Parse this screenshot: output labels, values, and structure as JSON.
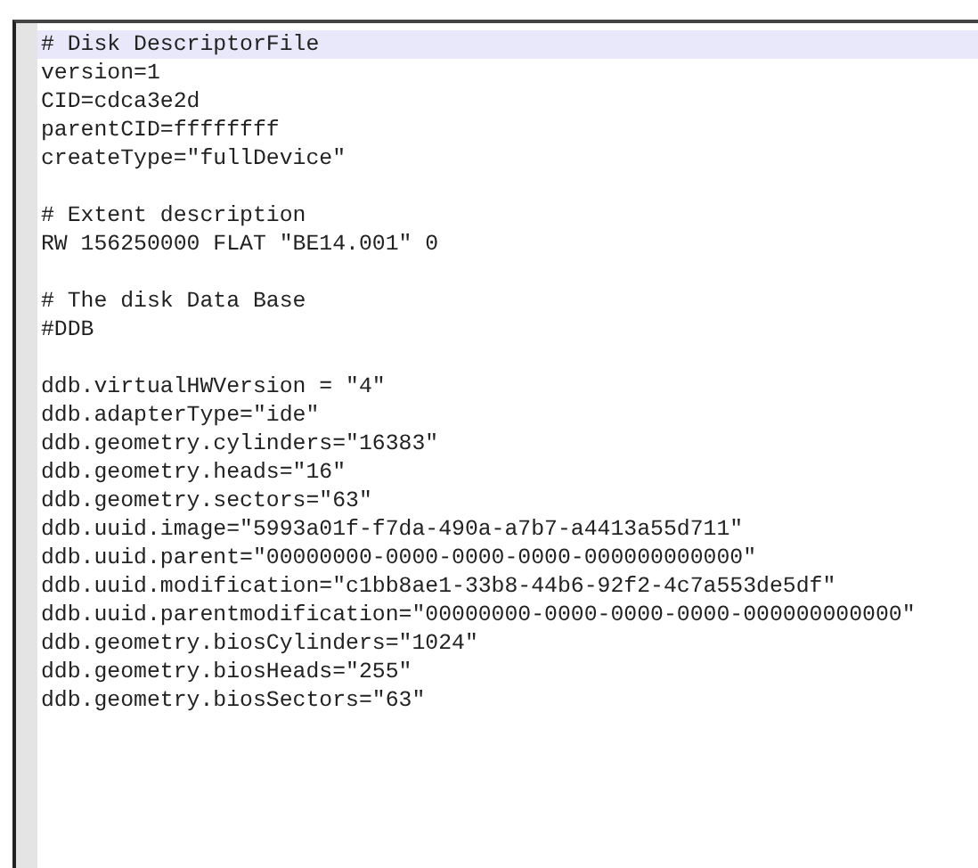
{
  "editor": {
    "blocks": [
      [
        {
          "text": "# Disk DescriptorFile",
          "current": true
        },
        {
          "text": "version=1",
          "current": false
        },
        {
          "text": "CID=cdca3e2d",
          "current": false
        },
        {
          "text": "parentCID=ffffffff",
          "current": false
        },
        {
          "text": "createType=\"fullDevice\"",
          "current": false
        }
      ],
      [
        {
          "text": "# Extent description",
          "current": false
        },
        {
          "text": "RW 156250000 FLAT \"BE14.001\" 0",
          "current": false
        }
      ],
      [
        {
          "text": "# The disk Data Base",
          "current": false
        },
        {
          "text": "#DDB",
          "current": false
        }
      ],
      [
        {
          "text": "ddb.virtualHWVersion = \"4\"",
          "current": false
        },
        {
          "text": "ddb.adapterType=\"ide\"",
          "current": false
        },
        {
          "text": "ddb.geometry.cylinders=\"16383\"",
          "current": false
        },
        {
          "text": "ddb.geometry.heads=\"16\"",
          "current": false
        },
        {
          "text": "ddb.geometry.sectors=\"63\"",
          "current": false
        },
        {
          "text": "ddb.uuid.image=\"5993a01f-f7da-490a-a7b7-a4413a55d711\"",
          "current": false
        },
        {
          "text": "ddb.uuid.parent=\"00000000-0000-0000-0000-000000000000\"",
          "current": false
        },
        {
          "text": "ddb.uuid.modification=\"c1bb8ae1-33b8-44b6-92f2-4c7a553de5df\"",
          "current": false
        },
        {
          "text": "ddb.uuid.parentmodification=\"00000000-0000-0000-0000-000000000000\"",
          "current": false
        },
        {
          "text": "ddb.geometry.biosCylinders=\"1024\"",
          "current": false
        },
        {
          "text": "ddb.geometry.biosHeads=\"255\"",
          "current": false
        },
        {
          "text": "ddb.geometry.biosSectors=\"63\"",
          "current": false
        }
      ]
    ]
  }
}
